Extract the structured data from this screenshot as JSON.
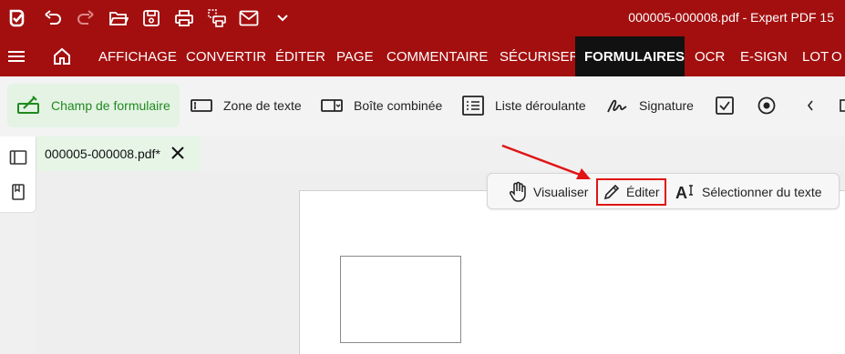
{
  "window": {
    "title": "000005-000008.pdf  -  Expert PDF 15"
  },
  "quick_access": [
    {
      "name": "app-logo-icon"
    },
    {
      "name": "undo-icon"
    },
    {
      "name": "redo-icon"
    },
    {
      "name": "open-folder-icon"
    },
    {
      "name": "save-icon"
    },
    {
      "name": "print-icon"
    },
    {
      "name": "scan-print-icon"
    },
    {
      "name": "email-icon"
    },
    {
      "name": "chevron-down-icon"
    }
  ],
  "menu": {
    "items": [
      "AFFICHAGE",
      "CONVERTIR",
      "ÉDITER",
      "PAGE",
      "COMMENTAIRE",
      "SÉCURISER",
      "FORMULAIRES",
      "OCR",
      "E-SIGN",
      "LOT",
      "O"
    ],
    "active": "FORMULAIRES"
  },
  "ribbon": {
    "form_field": "Champ de formulaire",
    "text_zone": "Zone de texte",
    "combo_box": "Boîte combinée",
    "list_box": "Liste déroulante",
    "signature": "Signature"
  },
  "document": {
    "tab_label": "000005-000008.pdf*"
  },
  "mode_toolbar": {
    "view": "Visualiser",
    "edit": "Éditer",
    "select_text": "Sélectionner du texte"
  },
  "colors": {
    "brand_red": "#a30f0f",
    "active_menu_bg": "#111111",
    "ribbon_active_green": "#1f8a1f",
    "highlight_red": "#e01414"
  }
}
